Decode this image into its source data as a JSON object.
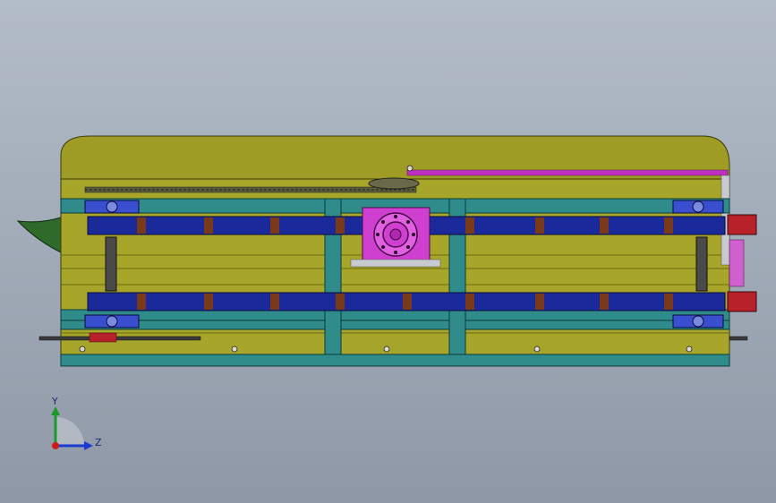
{
  "viewport": {
    "view": "front",
    "colors": {
      "background_top": "#b3bcc8",
      "background_bottom": "#8e98a6",
      "frame_olive": "#a7a52a",
      "cover_olive": "#9e9c24",
      "rail_teal": "#2f8c8a",
      "chain_blue": "#1a2a9a",
      "gearbox_magenta": "#d040d0",
      "bearing_blue": "#3a4fd0",
      "end_red": "#b8202a",
      "fin_green": "#2f6a2a"
    }
  },
  "triad": {
    "y_label": "Y",
    "z_label": "Z",
    "y_color": "#1a9a2a",
    "z_color": "#1a3ad0",
    "origin_color": "#d01a1a"
  }
}
